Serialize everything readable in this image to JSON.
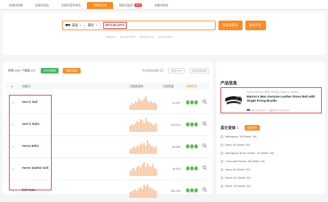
{
  "tabs": [
    {
      "label": "关键词挖掘",
      "active": false
    },
    {
      "label": "关键词选品",
      "active": false
    },
    {
      "label": "关键词竞争商品",
      "active": false
    },
    {
      "label": "关键词反查",
      "active": true
    },
    {
      "label": "搜索词监控",
      "active": false,
      "badge": "NEW"
    },
    {
      "label": "关键词收录",
      "active": false
    }
  ],
  "search": {
    "country": "美国",
    "period": "最近",
    "asin": "B07L9KAZFG",
    "query_button": "反查流量词",
    "history_button": "查询历史",
    "examples": [
      "B08MXN",
      "B07B83TWPR",
      "B07NQYYG7",
      "B07L9NW9JI"
    ]
  },
  "toolbar": {
    "found_prefix": "找到",
    "found_count": "203+",
    "found_suffix": "个搜索入口",
    "add_keyword_button": "ADD关键词",
    "add_to_library_button": "关键词加到",
    "similar_label": "包含相似标题",
    "export_button": "导出Excel",
    "help_button": "如何使用功能"
  },
  "table": {
    "headers": {
      "index": "#",
      "keyword": "流量词",
      "trend": "月搜索趋势",
      "volume": "月搜索量",
      "competition": "供需竞争"
    },
    "rows": [
      {
        "index": "1",
        "keyword": "men's belt",
        "volume": "91,537",
        "trend": [
          5,
          7,
          6,
          9,
          8,
          12,
          10,
          9,
          11,
          14,
          10,
          8,
          9,
          7,
          8,
          6
        ]
      },
      {
        "index": "2",
        "keyword": "men's belts",
        "volume": "103,014",
        "trend": [
          6,
          8,
          7,
          9,
          11,
          10,
          13,
          12,
          9,
          14,
          11,
          10,
          9,
          8,
          7,
          9
        ]
      },
      {
        "index": "3",
        "keyword": "mens belts",
        "volume": "89,680",
        "trend": [
          5,
          6,
          8,
          7,
          9,
          8,
          11,
          10,
          12,
          9,
          15,
          11,
          9,
          8,
          7,
          8
        ]
      },
      {
        "index": "4",
        "keyword": "mens leather belt",
        "volume": "46,833",
        "trend": [
          4,
          6,
          7,
          5,
          8,
          9,
          7,
          10,
          12,
          8,
          11,
          9,
          8,
          10,
          7,
          6
        ]
      },
      {
        "index": "5",
        "keyword": "belt man",
        "volume": "281,245",
        "trend": [
          6,
          7,
          8,
          9,
          7,
          10,
          11,
          9,
          13,
          12,
          14,
          11,
          10,
          9,
          8,
          7
        ]
      }
    ],
    "competition_level": 3
  },
  "product": {
    "section_title": "产品信息",
    "meta": "Marino Avenue | 男性 Clothing, Shoes & Jewelry",
    "title": "Marino's Men Genuine Leather Dress Belt with Single Prong Buckle",
    "asin": "B07L9KAZFG",
    "listed": "上架时间: 2018-08-09"
  },
  "variants": {
    "title": "其它变体",
    "count": "6",
    "button": "批量查询",
    "items": [
      "Mahogany, 36 (Waist: 34)",
      "Navy, 48 (Waist: 46)",
      "Mahogany/ Burnt Umber, 40 (Waist: 38)",
      "Chocolate Brown, 36 (Waist: 34)",
      "Navy, 54 (Waist: 52)",
      "Black, 60 (Waist: 58)",
      "Black, 46 (Waist: 44)"
    ]
  },
  "colors": {
    "accent": "#ff8a1f",
    "highlight": "#e53935",
    "success": "#3dbb61"
  }
}
